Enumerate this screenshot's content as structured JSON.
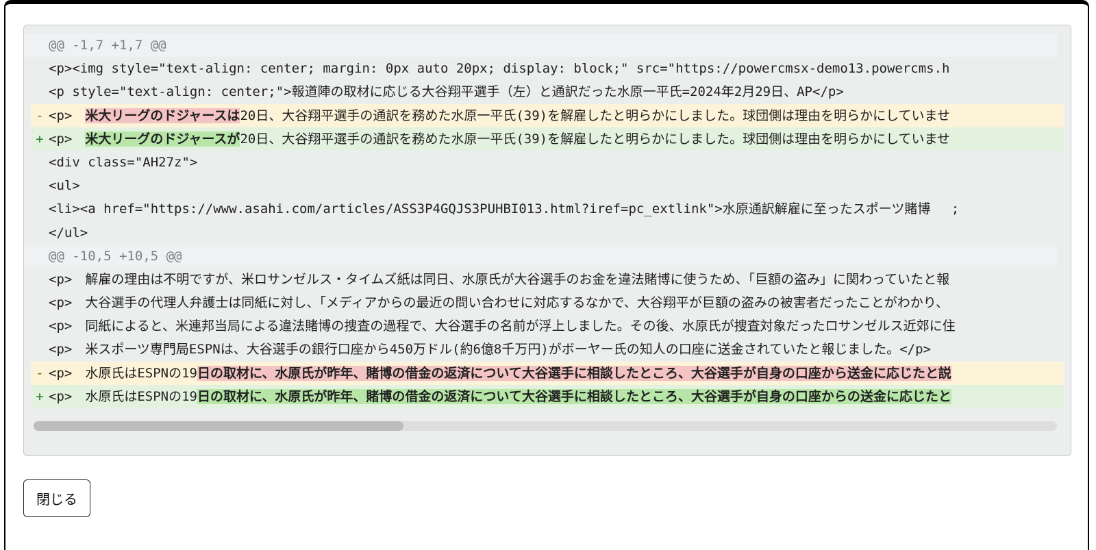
{
  "close_button_label": "閉じる",
  "diff": {
    "hunk1_header": "@@ -1,7 +1,7 @@",
    "h1_line1": "<p><img style=\"text-align: center; margin: 0px auto 20px; display: block;\" src=\"https://powercmsx-demo13.powercms.h",
    "h1_line2": "<p style=\"text-align: center;\">報道陣の取材に応じる大谷翔平選手（左）と通訳だった水原一平氏=2024年2月29日、AP</p>",
    "h1_del_pre": "<p>　",
    "h1_del_hl": "米大リーグのドジャースは",
    "h1_del_post": "20日、大谷翔平選手の通訳を務めた水原一平氏(39)を解雇したと明らかにしました。球団側は理由を明らかにしていませ",
    "h1_add_pre": "<p>　",
    "h1_add_hl": "米大リーグのドジャースが",
    "h1_add_post": "20日、大谷翔平選手の通訳を務めた水原一平氏(39)を解雇したと明らかにしました。球団側は理由を明らかにしていませ",
    "h1_line5": "<div class=\"AH27z\">",
    "h1_line6": "<ul>",
    "h1_line7": "<li><a href=\"https://www.asahi.com/articles/ASS3P4GQJS3PUHBI013.html?iref=pc_extlink\">水原通訳解雇に至ったスポーツ賭博　 ;",
    "h1_line8": "</ul>",
    "hunk2_header": "@@ -10,5 +10,5 @@",
    "h2_line1": "<p>　解雇の理由は不明ですが、米ロサンゼルス・タイムズ紙は同日、水原氏が大谷選手のお金を違法賭博に使うため、「巨額の盗み」に関わっていたと報",
    "h2_line2": "<p>　大谷選手の代理人弁護士は同紙に対し、「メディアからの最近の問い合わせに対応するなかで、大谷翔平が巨額の盗みの被害者だったことがわかり、",
    "h2_line3": "<p>　同紙によると、米連邦当局による違法賭博の捜査の過程で、大谷選手の名前が浮上しました。その後、水原氏が捜査対象だったロサンゼルス近郊に住",
    "h2_line4": "<p>　米スポーツ専門局ESPNは、大谷選手の銀行口座から450万ドル(約6億8千万円)がボーヤー氏の知人の口座に送金されていたと報じました。</p>",
    "h2_del_pre": "<p>　水原氏はESPNの19",
    "h2_del_hl": "日の取材に、水原氏が昨年、賭博の借金の返済について大谷選手に相談したところ、大谷選手が自身の口座から送金に応じたと説",
    "h2_add_pre": "<p>　水原氏はESPNの19",
    "h2_add_hl": "日の取材に、水原氏が昨年、賭博の借金の返済について大谷選手に相談したところ、大谷選手が自身の口座からの送金に応じたと"
  },
  "signs": {
    "minus": "-",
    "plus": "+"
  }
}
